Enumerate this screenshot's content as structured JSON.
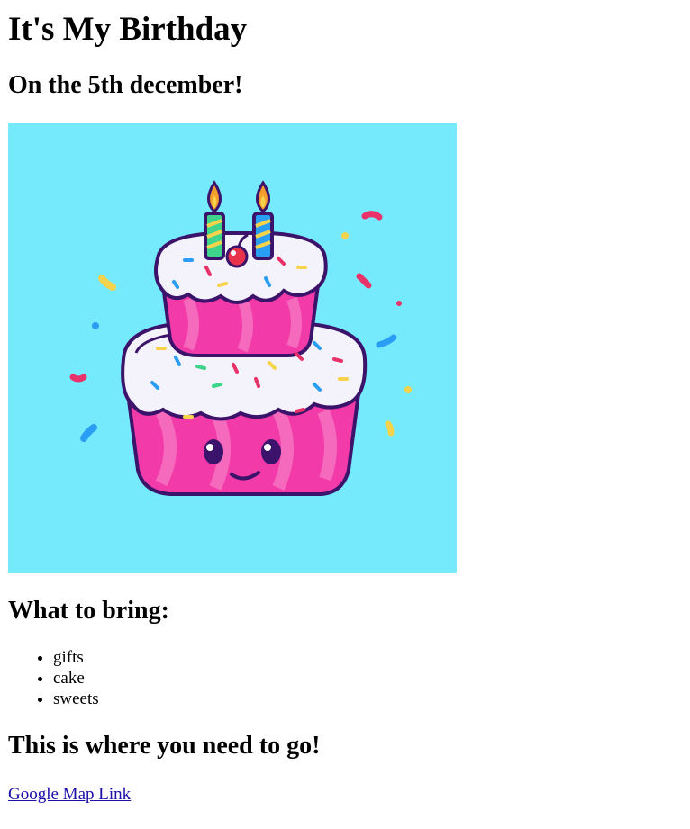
{
  "page": {
    "title": "It's My Birthday",
    "date_heading": "On the 5th december!",
    "bring_heading": "What to bring:",
    "bring_items": [
      "gifts",
      "cake",
      "sweets"
    ],
    "directions_heading": "This is where you need to go!",
    "map_link_label": "Google Map Link"
  },
  "colors": {
    "image_background": "#76EAFD",
    "link": "#1a0dab",
    "cake_pink": "#F23BA8",
    "cake_outline": "#3B136B",
    "frosting": "#F4F2FA"
  },
  "image": {
    "subject": "cartoon-birthday-cake-icon"
  }
}
